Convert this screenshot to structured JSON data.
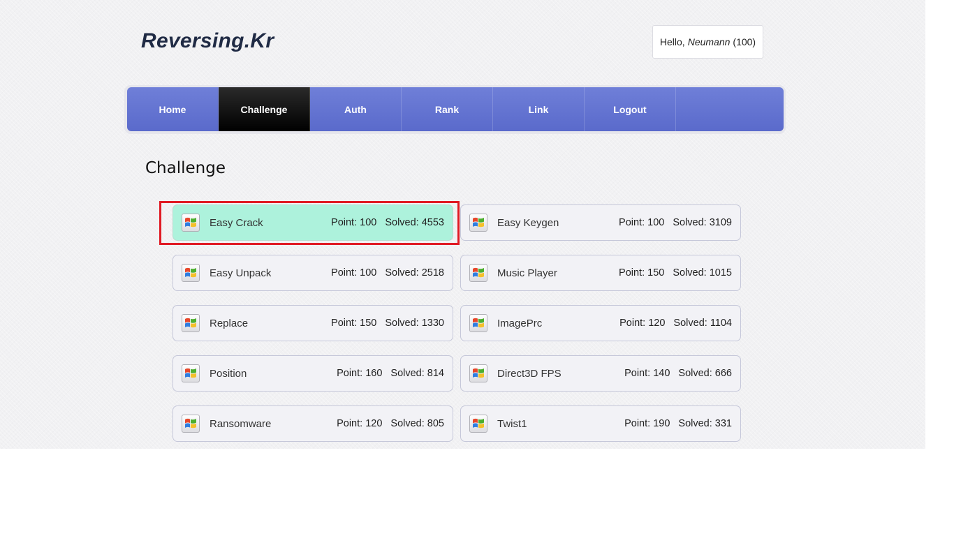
{
  "site": {
    "logo": "Reversing.Kr"
  },
  "user": {
    "greeting": "Hello,",
    "name": "Neumann",
    "score": "(100)"
  },
  "nav": {
    "home": "Home",
    "challenge": "Challenge",
    "auth": "Auth",
    "rank": "Rank",
    "link": "Link",
    "logout": "Logout",
    "active": "Challenge"
  },
  "page": {
    "title": "Challenge"
  },
  "challenges": [
    {
      "name": "Easy Crack",
      "point": "Point: 100",
      "solved": "Solved: 4553",
      "highlighted": true
    },
    {
      "name": "Easy Keygen",
      "point": "Point: 100",
      "solved": "Solved: 3109"
    },
    {
      "name": "Easy Unpack",
      "point": "Point: 100",
      "solved": "Solved: 2518"
    },
    {
      "name": "Music Player",
      "point": "Point: 150",
      "solved": "Solved: 1015"
    },
    {
      "name": "Replace",
      "point": "Point: 150",
      "solved": "Solved: 1330"
    },
    {
      "name": "ImagePrc",
      "point": "Point: 120",
      "solved": "Solved: 1104"
    },
    {
      "name": "Position",
      "point": "Point: 160",
      "solved": "Solved: 814"
    },
    {
      "name": "Direct3D FPS",
      "point": "Point: 140",
      "solved": "Solved: 666"
    },
    {
      "name": "Ransomware",
      "point": "Point: 120",
      "solved": "Solved: 805"
    },
    {
      "name": "Twist1",
      "point": "Point: 190",
      "solved": "Solved: 331"
    }
  ],
  "colors": {
    "nav": "#6373d2",
    "active": "#000000",
    "highlight": "#adf2dc",
    "outline": "#e01a24"
  },
  "icons": {
    "challenge": "windows-logo-icon"
  }
}
